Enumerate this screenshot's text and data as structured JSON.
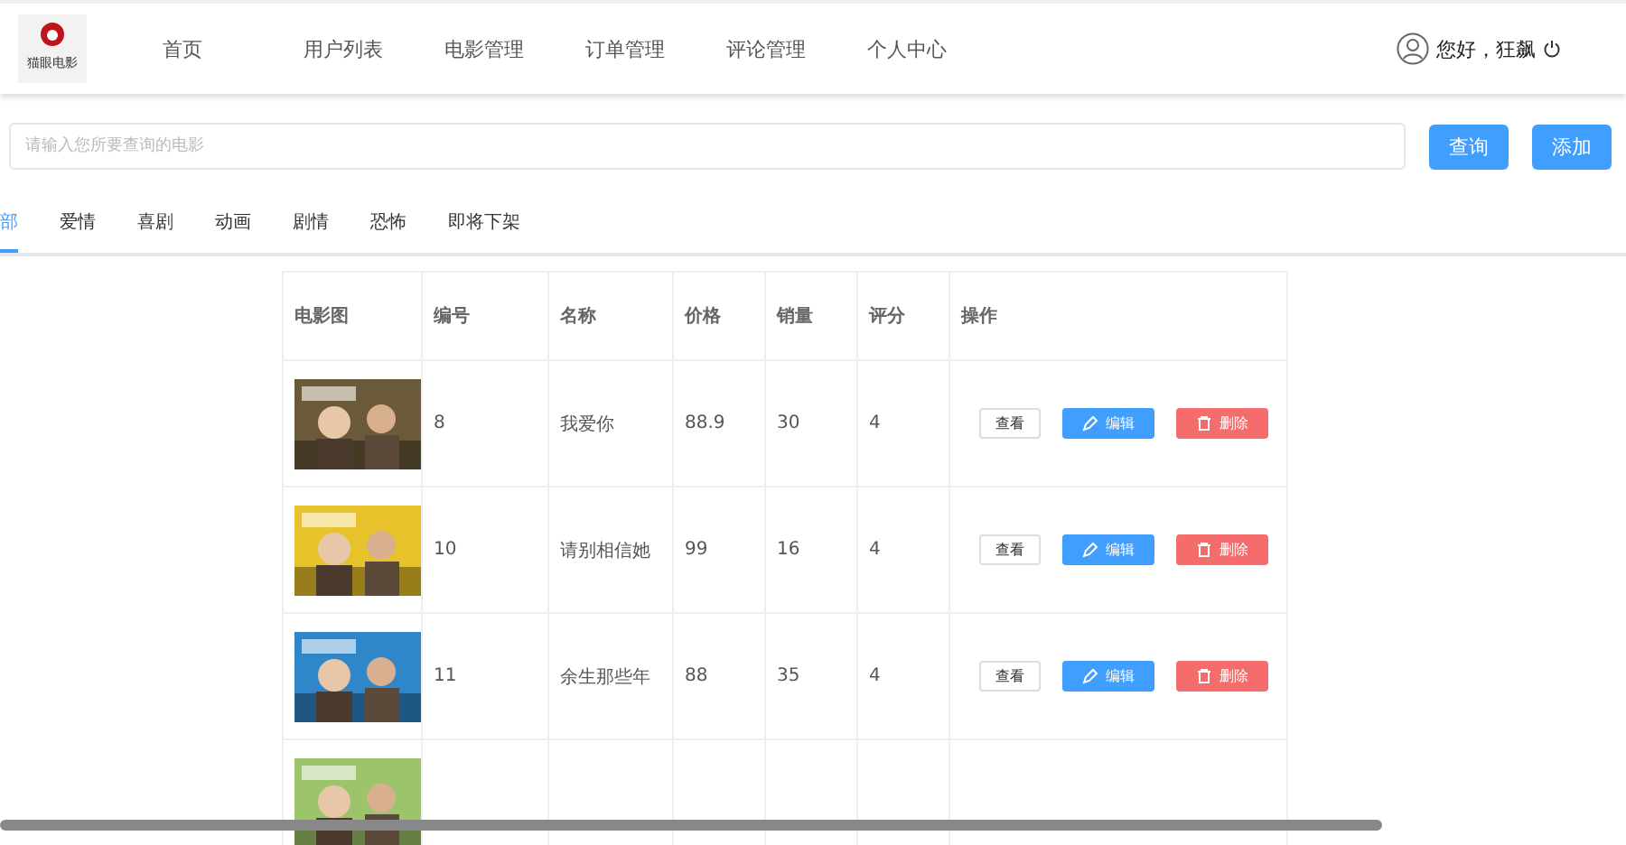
{
  "logo": {
    "text": "猫眼电影"
  },
  "nav": [
    {
      "label": "首页",
      "selected": false
    },
    {
      "label": "用户列表",
      "selected": false
    },
    {
      "label": "电影管理",
      "selected": false
    },
    {
      "label": "订单管理",
      "selected": false
    },
    {
      "label": "评论管理",
      "selected": false
    },
    {
      "label": "个人中心",
      "selected": false
    }
  ],
  "user": {
    "greeting": "您好，狂飙"
  },
  "search": {
    "placeholder": "请输入您所要查询的电影"
  },
  "search_buttons": [
    "查询",
    "添加"
  ],
  "tabs": [
    {
      "label": "部",
      "selected": true
    },
    {
      "label": "爱情",
      "selected": false
    },
    {
      "label": "喜剧",
      "selected": false
    },
    {
      "label": "动画",
      "selected": false
    },
    {
      "label": "剧情",
      "selected": false
    },
    {
      "label": "恐怖",
      "selected": false
    },
    {
      "label": "即将下架",
      "selected": false
    }
  ],
  "table": {
    "columns": [
      "电影图",
      "编号",
      "名称",
      "价格",
      "销量",
      "评分",
      "操作"
    ],
    "rows": [
      {
        "picture": {
          "kind": "picture",
          "color": "#6b5a3a"
        },
        "id": "8",
        "name": "我爱你",
        "price": "88.9",
        "sales": "30",
        "rating": "4",
        "actions": [
          {
            "kind": "view",
            "label": "查看"
          },
          {
            "kind": "edit",
            "label": "编辑"
          },
          {
            "kind": "delete",
            "label": "删除"
          }
        ]
      },
      {
        "picture": {
          "kind": "picture",
          "color": "#e8c22a"
        },
        "id": "10",
        "name": "请别相信她",
        "price": "99",
        "sales": "16",
        "rating": "4",
        "actions": [
          {
            "kind": "view",
            "label": "查看"
          },
          {
            "kind": "edit",
            "label": "编辑"
          },
          {
            "kind": "delete",
            "label": "删除"
          }
        ]
      },
      {
        "picture": {
          "kind": "picture",
          "color": "#2f86c8"
        },
        "id": "11",
        "name": "余生那些年",
        "price": "88",
        "sales": "35",
        "rating": "4",
        "actions": [
          {
            "kind": "view",
            "label": "查看"
          },
          {
            "kind": "edit",
            "label": "编辑"
          },
          {
            "kind": "delete",
            "label": "删除"
          }
        ]
      },
      {
        "picture": {
          "kind": "picture",
          "color": "#9cc46a"
        }
      }
    ]
  }
}
